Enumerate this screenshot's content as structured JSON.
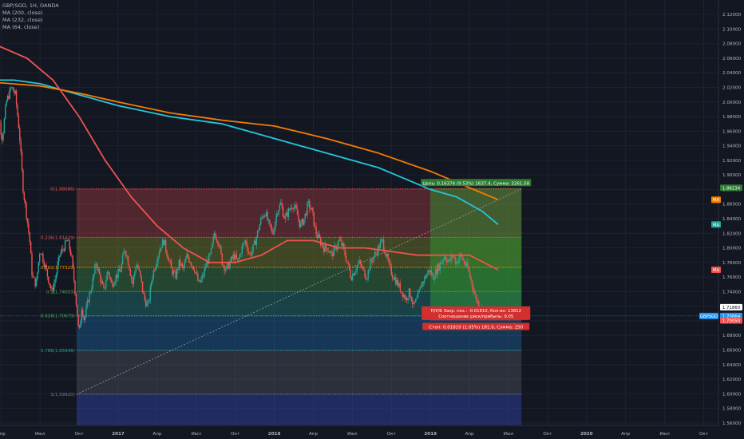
{
  "legend": {
    "symbol_line": "GBP/SGD, 1H, OANDA",
    "ma1": "MA (200, close)",
    "ma2": "MA (232, close)",
    "ma3": "MA (64, close)"
  },
  "chart_data": {
    "type": "candlestick",
    "symbol": "GBP/SGD",
    "timeframe": "1H",
    "broker": "OANDA",
    "ylim": [
      1.55,
      2.13
    ],
    "y_ticks": [
      "2.12000",
      "2.10000",
      "2.08000",
      "2.06000",
      "2.04000",
      "2.02000",
      "2.00000",
      "1.98000",
      "1.96000",
      "1.94000",
      "1.92000",
      "1.90000",
      "1.88000",
      "1.86000",
      "1.84000",
      "1.82000",
      "1.80000",
      "1.78000",
      "1.76000",
      "1.74000",
      "1.72000",
      "1.70000",
      "1.68000",
      "1.66000",
      "1.64000",
      "1.62000",
      "1.60000",
      "1.58000",
      "1.56000"
    ],
    "x_ticks": [
      "Апр",
      "Июл",
      "Окт",
      "2017",
      "Апр",
      "Июл",
      "Окт",
      "2018",
      "Апр",
      "Июл",
      "Окт",
      "2019",
      "Апр",
      "Июл",
      "Окт",
      "2020",
      "Апр",
      "Июл",
      "Окт"
    ],
    "x_tick_months": [
      -9,
      -6,
      -3,
      0,
      3,
      6,
      9,
      12,
      15,
      18,
      21,
      24,
      27,
      30,
      33,
      36,
      39,
      42,
      45
    ],
    "close_path": [
      [
        -9.6,
        2.02
      ],
      [
        -9.2,
        1.98
      ],
      [
        -8.9,
        1.95
      ],
      [
        -8.6,
        2.0
      ],
      [
        -8.2,
        2.02
      ],
      [
        -7.9,
        2.01
      ],
      [
        -7.6,
        1.96
      ],
      [
        -7.3,
        1.88
      ],
      [
        -7.0,
        1.84
      ],
      [
        -6.8,
        1.81
      ],
      [
        -6.6,
        1.76
      ],
      [
        -6.3,
        1.75
      ],
      [
        -6.0,
        1.8
      ],
      [
        -5.7,
        1.78
      ],
      [
        -5.4,
        1.76
      ],
      [
        -5.1,
        1.74
      ],
      [
        -4.8,
        1.76
      ],
      [
        -4.5,
        1.79
      ],
      [
        -4.2,
        1.8
      ],
      [
        -3.9,
        1.81
      ],
      [
        -3.6,
        1.79
      ],
      [
        -3.3,
        1.74
      ],
      [
        -3.1,
        1.7
      ],
      [
        -3.0,
        1.68
      ],
      [
        -2.8,
        1.72
      ],
      [
        -2.6,
        1.7
      ],
      [
        -2.3,
        1.73
      ],
      [
        -2.0,
        1.75
      ],
      [
        -1.7,
        1.78
      ],
      [
        -1.4,
        1.76
      ],
      [
        -1.1,
        1.74
      ],
      [
        -0.8,
        1.77
      ],
      [
        -0.5,
        1.75
      ],
      [
        -0.2,
        1.76
      ],
      [
        0.2,
        1.77
      ],
      [
        0.5,
        1.8
      ],
      [
        0.8,
        1.78
      ],
      [
        1.1,
        1.75
      ],
      [
        1.4,
        1.78
      ],
      [
        1.7,
        1.76
      ],
      [
        2.0,
        1.73
      ],
      [
        2.3,
        1.72
      ],
      [
        2.6,
        1.76
      ],
      [
        2.9,
        1.78
      ],
      [
        3.2,
        1.8
      ],
      [
        3.5,
        1.81
      ],
      [
        3.8,
        1.79
      ],
      [
        4.1,
        1.77
      ],
      [
        4.4,
        1.76
      ],
      [
        4.7,
        1.78
      ],
      [
        5.0,
        1.77
      ],
      [
        5.3,
        1.79
      ],
      [
        5.6,
        1.78
      ],
      [
        5.9,
        1.77
      ],
      [
        6.2,
        1.75
      ],
      [
        6.5,
        1.76
      ],
      [
        6.8,
        1.78
      ],
      [
        7.1,
        1.79
      ],
      [
        7.4,
        1.82
      ],
      [
        7.7,
        1.81
      ],
      [
        8.0,
        1.78
      ],
      [
        8.3,
        1.77
      ],
      [
        8.6,
        1.78
      ],
      [
        8.9,
        1.79
      ],
      [
        9.2,
        1.78
      ],
      [
        9.5,
        1.8
      ],
      [
        9.8,
        1.81
      ],
      [
        10.1,
        1.79
      ],
      [
        10.4,
        1.8
      ],
      [
        10.7,
        1.82
      ],
      [
        11.0,
        1.84
      ],
      [
        11.3,
        1.85
      ],
      [
        11.6,
        1.83
      ],
      [
        11.9,
        1.82
      ],
      [
        12.2,
        1.85
      ],
      [
        12.5,
        1.86
      ],
      [
        12.8,
        1.84
      ],
      [
        13.1,
        1.85
      ],
      [
        13.4,
        1.86
      ],
      [
        13.7,
        1.85
      ],
      [
        14.0,
        1.83
      ],
      [
        14.3,
        1.84
      ],
      [
        14.6,
        1.86
      ],
      [
        14.9,
        1.85
      ],
      [
        15.2,
        1.82
      ],
      [
        15.5,
        1.81
      ],
      [
        15.8,
        1.8
      ],
      [
        16.1,
        1.8
      ],
      [
        16.4,
        1.79
      ],
      [
        16.7,
        1.8
      ],
      [
        17.0,
        1.81
      ],
      [
        17.3,
        1.8
      ],
      [
        17.6,
        1.78
      ],
      [
        17.9,
        1.76
      ],
      [
        18.2,
        1.77
      ],
      [
        18.5,
        1.78
      ],
      [
        18.8,
        1.77
      ],
      [
        19.1,
        1.76
      ],
      [
        19.4,
        1.78
      ],
      [
        19.7,
        1.79
      ],
      [
        20.0,
        1.8
      ],
      [
        20.3,
        1.81
      ],
      [
        20.6,
        1.79
      ],
      [
        20.9,
        1.77
      ],
      [
        21.2,
        1.76
      ],
      [
        21.5,
        1.75
      ],
      [
        21.8,
        1.74
      ],
      [
        22.1,
        1.73
      ],
      [
        22.4,
        1.74
      ],
      [
        22.7,
        1.72
      ],
      [
        23.0,
        1.73
      ],
      [
        23.3,
        1.75
      ],
      [
        23.6,
        1.76
      ],
      [
        23.9,
        1.77
      ],
      [
        24.2,
        1.76
      ],
      [
        24.5,
        1.77
      ],
      [
        24.8,
        1.78
      ],
      [
        25.1,
        1.79
      ],
      [
        25.4,
        1.78
      ],
      [
        25.7,
        1.79
      ],
      [
        26.0,
        1.78
      ],
      [
        26.3,
        1.79
      ],
      [
        26.6,
        1.78
      ],
      [
        26.9,
        1.77
      ],
      [
        27.2,
        1.75
      ],
      [
        27.5,
        1.73
      ],
      [
        27.8,
        1.72
      ],
      [
        28.1,
        1.71
      ],
      [
        28.3,
        1.7066
      ]
    ],
    "series": [
      {
        "name": "MA (200, close)",
        "color": "#26c6da",
        "points": [
          [
            -9.6,
            2.03
          ],
          [
            -8,
            2.03
          ],
          [
            -6,
            2.025
          ],
          [
            -3,
            2.01
          ],
          [
            0,
            1.995
          ],
          [
            4,
            1.98
          ],
          [
            8,
            1.97
          ],
          [
            12,
            1.95
          ],
          [
            16,
            1.93
          ],
          [
            20,
            1.91
          ],
          [
            24,
            1.88
          ],
          [
            26,
            1.87
          ],
          [
            28,
            1.85
          ],
          [
            29.2,
            1.832
          ]
        ]
      },
      {
        "name": "MA (232, close)",
        "color": "#f57c00",
        "points": [
          [
            -9.6,
            2.027
          ],
          [
            -6,
            2.022
          ],
          [
            -3,
            2.012
          ],
          [
            0,
            2.0
          ],
          [
            4,
            1.985
          ],
          [
            8,
            1.975
          ],
          [
            12,
            1.967
          ],
          [
            16,
            1.95
          ],
          [
            20,
            1.93
          ],
          [
            24,
            1.905
          ],
          [
            26,
            1.89
          ],
          [
            28,
            1.875
          ],
          [
            29.2,
            1.866
          ]
        ]
      },
      {
        "name": "MA (64, close)",
        "color": "#ef5350",
        "points": [
          [
            -9.6,
            2.08
          ],
          [
            -7,
            2.06
          ],
          [
            -5,
            2.03
          ],
          [
            -3,
            1.98
          ],
          [
            -1,
            1.92
          ],
          [
            1,
            1.87
          ],
          [
            3,
            1.83
          ],
          [
            5,
            1.8
          ],
          [
            7,
            1.78
          ],
          [
            9,
            1.78
          ],
          [
            11,
            1.79
          ],
          [
            13,
            1.81
          ],
          [
            15,
            1.81
          ],
          [
            17,
            1.8
          ],
          [
            19,
            1.8
          ],
          [
            21,
            1.795
          ],
          [
            23,
            1.79
          ],
          [
            25,
            1.79
          ],
          [
            27,
            1.79
          ],
          [
            29.2,
            1.77
          ]
        ]
      }
    ],
    "fib_levels": [
      {
        "label": "0(1.88086)",
        "value": 1.88086,
        "color": "#ef5350"
      },
      {
        "label": "0.236(1.81439)",
        "value": 1.81439,
        "color": "#ef5350"
      },
      {
        "label": "0.382(1.77329)",
        "value": 1.77329,
        "color": "#ff9800"
      },
      {
        "label": "0.5(1.74003)",
        "value": 1.74003,
        "color": "#4caf50"
      },
      {
        "label": "0.618(1.70679)",
        "value": 1.70679,
        "color": "#4caf50"
      },
      {
        "label": "0.786(1.65948)",
        "value": 1.65948,
        "color": "#26a69a"
      },
      {
        "label": "1(1.59920)",
        "value": 1.5992,
        "color": "#787b86"
      }
    ],
    "fib_zones": [
      {
        "top": 1.88086,
        "bottom": 1.81439,
        "color": "rgba(239,83,80,0.28)"
      },
      {
        "top": 1.81439,
        "bottom": 1.77329,
        "color": "rgba(150,160,40,0.34)"
      },
      {
        "top": 1.77329,
        "bottom": 1.74003,
        "color": "rgba(76,175,80,0.30)"
      },
      {
        "top": 1.74003,
        "bottom": 1.70679,
        "color": "rgba(38,166,154,0.30)"
      },
      {
        "top": 1.70679,
        "bottom": 1.65948,
        "color": "rgba(33,150,243,0.25)"
      },
      {
        "top": 1.65948,
        "bottom": 1.5992,
        "color": "rgba(120,123,134,0.25)"
      },
      {
        "top": 1.5992,
        "bottom": 1.55,
        "color": "rgba(48,63,159,0.50)"
      }
    ],
    "fib_range_months": [
      -3.2,
      31.0
    ],
    "trend_line": [
      [
        -3.2,
        1.5992
      ],
      [
        31.0,
        1.88086
      ]
    ],
    "position": {
      "start_month": 24.0,
      "end_month": 31.0,
      "entry": 1.7186,
      "target": 1.88234,
      "stop": 1.7005,
      "target_label": "Цель: 0.16374 (9.53%) 1637.4, Сумма: 3261.58",
      "pnl_label_1": "П/У/Б Закр. поз.: -0.01810, Кол-во: 13812",
      "pnl_label_2": "Соотношение риск/прибыль: 9.05",
      "stop_label": "Стоп: 0.01810 (1.05%) 181.0, Сумма: 250"
    },
    "price_badges": [
      {
        "text": "1.88234",
        "value": 1.88234,
        "bg": "#2e7d32",
        "fg": "#ffffff"
      },
      {
        "text": "MA",
        "value": 1.866,
        "bg": "#f57c00",
        "fg": "#ffffff",
        "small": true
      },
      {
        "text": "MA",
        "value": 1.832,
        "bg": "#26a69a",
        "fg": "#ffffff",
        "small": true
      },
      {
        "text": "MA",
        "value": 1.77,
        "bg": "#ef5350",
        "fg": "#ffffff",
        "small": true
      },
      {
        "text": "1.71860",
        "value": 1.7186,
        "bg": "#ffffff",
        "fg": "#131722"
      },
      {
        "text": "1.70664",
        "value": 1.70664,
        "bg": "#2196f3",
        "fg": "#ffffff"
      },
      {
        "text": "1.70050",
        "value": 1.7005,
        "bg": "#ef5350",
        "fg": "#ffffff"
      }
    ],
    "last_price_tag": "GBPSGD",
    "last_price": 1.70664,
    "colors": {
      "up": "#26a69a",
      "down": "#ef5350",
      "background": "#131722",
      "grid": "#1e2230",
      "axis_text": "#b2b5be"
    }
  }
}
